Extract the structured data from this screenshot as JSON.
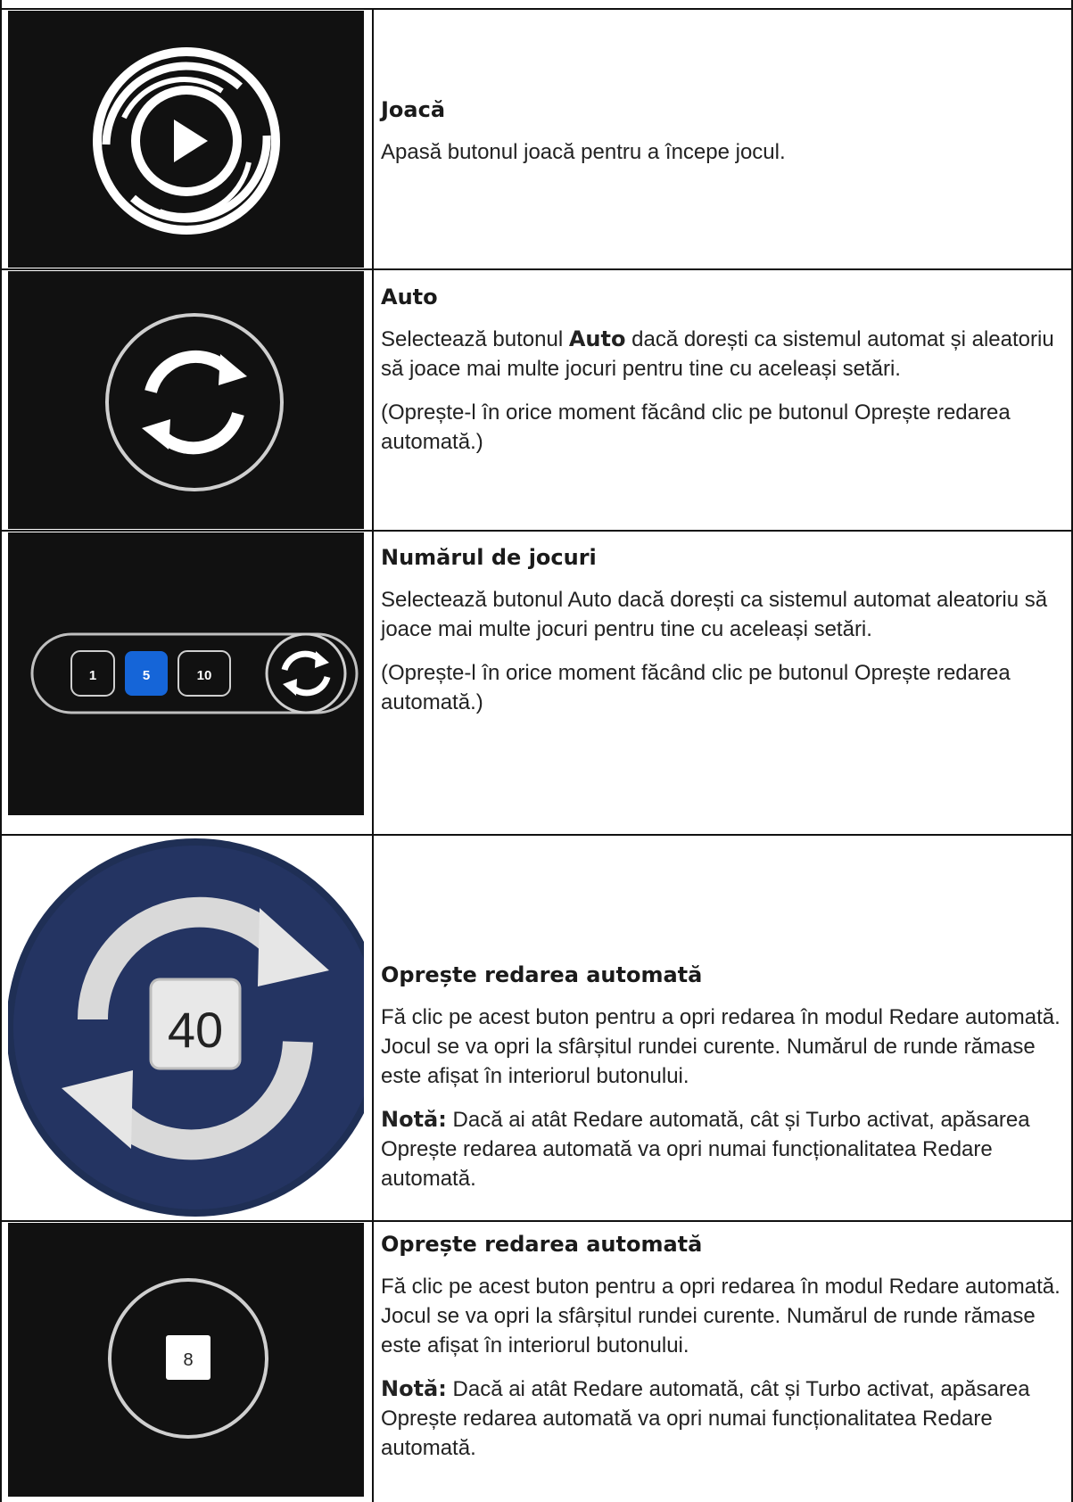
{
  "rows": [
    {
      "title": "Joacă",
      "paragraphs": [
        {
          "text": "Apasă butonul joacă pentru a începe jocul."
        }
      ],
      "icon": "play-icon"
    },
    {
      "title": "Auto",
      "p1_pre": "Selectează butonul ",
      "p1_bold": "Auto",
      "p1_post": " dacă dorești ca sistemul automat și aleatoriu să joace mai multe jocuri pentru tine cu aceleași setări.",
      "p2": "(Oprește-l în orice moment făcând clic pe butonul Oprește redarea automată.)",
      "icon": "autoplay-icon"
    },
    {
      "title": "Numărul de jocuri",
      "p1": "Selectează butonul Auto dacă dorești ca sistemul automat aleatoriu să joace mai multe jocuri pentru tine cu aceleași setări.",
      "p2": "(Oprește-l în orice moment făcând clic pe butonul Oprește redarea automată.)",
      "icon": "game-count-selector",
      "options": [
        "1",
        "5",
        "10"
      ],
      "selected_option": "5"
    },
    {
      "title": "Oprește redarea automată",
      "p1": "Fă clic pe acest buton pentru a opri redarea în modul Redare automată. Jocul se va opri la sfârșitul rundei curente. Numărul de runde rămase este afișat în interiorul butonului.",
      "note_label": "Notă:",
      "note_text": " Dacă ai atât Redare automată, cât și Turbo activat, apăsarea Oprește redarea automată va opri numai funcționalitatea Redare automată.",
      "icon": "stop-autoplay-icon",
      "counter": "40"
    },
    {
      "title": "Oprește redarea automată",
      "p1": "Fă clic pe acest buton pentru a opri redarea în modul Redare automată. Jocul se va opri la sfârșitul rundei curente. Numărul de runde rămase este afișat în interiorul butonului.",
      "note_label": "Notă:",
      "note_text": " Dacă ai atât Redare automată, cât și Turbo activat, apăsarea Oprește redarea automată va opri numai funcționalitatea Redare automată.",
      "icon": "stop-autoplay-icon",
      "counter": "8"
    }
  ],
  "colors": {
    "image_bg": "#111111",
    "selected_option": "#1565d8",
    "stop_button_blue": "#1f2f55"
  }
}
